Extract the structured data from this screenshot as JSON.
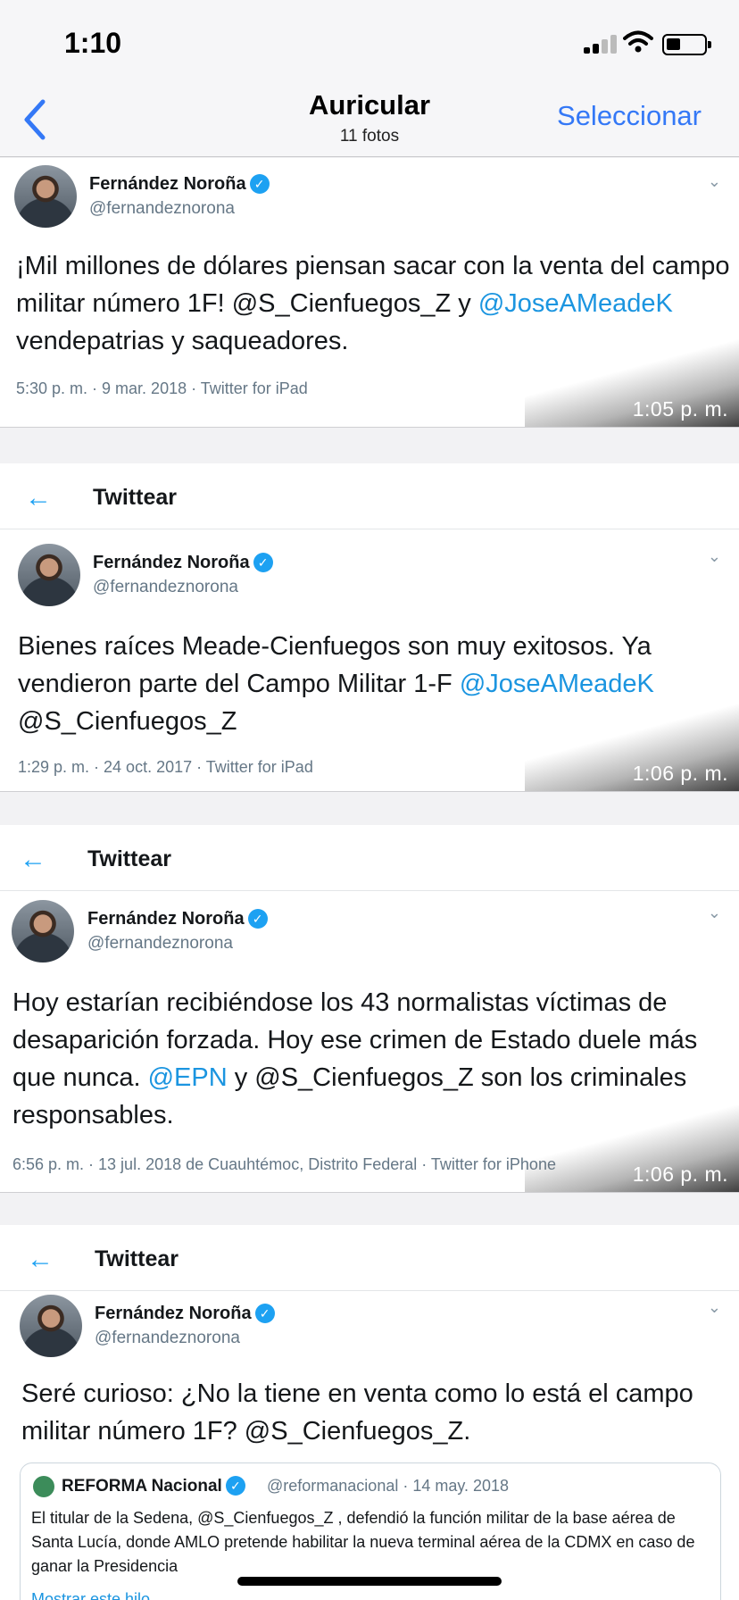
{
  "status_bar": {
    "time": "1:10",
    "signal_icon": "cellular-signal-icon",
    "wifi_icon": "wifi-icon",
    "battery_icon": "battery-icon"
  },
  "nav": {
    "back_icon": "chevron-left-icon",
    "title": "Auricular",
    "subtitle": "11 fotos",
    "select_label": "Seleccionar"
  },
  "colors": {
    "ios_blue": "#3478f6",
    "twitter_blue": "#1da1f2",
    "link_blue": "#1b95e0",
    "gray_text": "#657786"
  },
  "tweets": [
    {
      "header": "",
      "author": "Fernández Noroña",
      "handle": "@fernandeznorona",
      "text_parts": [
        "¡Mil millones de dólares piensan sacar con la venta del campo militar número 1F! @S_Cienfuegos_Z y ",
        "@JoseAMeadeK",
        " vendepatrias y saqueadores."
      ],
      "meta": "5:30 p. m. · 9 mar. 2018 · Twitter for iPad",
      "screenshot_time": "1:05 p. m."
    },
    {
      "header": "Twittear",
      "author": "Fernández Noroña",
      "handle": "@fernandeznorona",
      "text_parts": [
        "Bienes raíces Meade-Cienfuegos son muy exitosos. Ya vendieron parte del Campo Militar 1-F ",
        "@JoseAMeadeK",
        " @S_Cienfuegos_Z"
      ],
      "meta": "1:29 p. m. · 24 oct. 2017 · Twitter for iPad",
      "screenshot_time": "1:06 p. m."
    },
    {
      "header": "Twittear",
      "author": "Fernández Noroña",
      "handle": "@fernandeznorona",
      "text_parts": [
        "Hoy estarían recibiéndose los 43 normalistas víctimas de desaparición forzada. Hoy ese crimen de Estado duele más que nunca. ",
        "@EPN",
        " y @S_Cienfuegos_Z son los criminales responsables."
      ],
      "meta": "6:56 p. m. · 13 jul. 2018 de Cuauhtémoc, Distrito Federal · Twitter for iPhone",
      "screenshot_time": "1:06 p. m."
    },
    {
      "header": "Twittear",
      "author": "Fernández Noroña",
      "handle": "@fernandeznorona",
      "text_parts": [
        "Seré curioso: ¿No la tiene en venta como lo está el campo militar número 1F? @S_Cienfuegos_Z.",
        "",
        ""
      ],
      "quote": {
        "name": "REFORMA Nacional",
        "handle_date": "@reformanacional · 14 may. 2018",
        "text": "El titular de la Sedena, @S_Cienfuegos_Z , defendió la función militar de la base aérea de Santa Lucía, donde AMLO pretende habilitar la nueva terminal aérea de la CDMX en caso de ganar la Presidencia",
        "more": "Mostrar este hilo"
      }
    }
  ]
}
